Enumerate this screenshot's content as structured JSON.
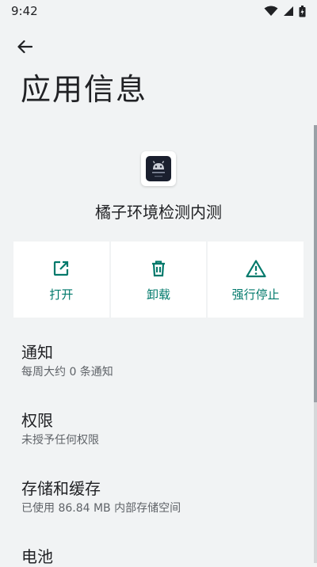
{
  "status_bar": {
    "time": "9:42"
  },
  "page": {
    "title": "应用信息"
  },
  "app": {
    "name": "橘子环境检测内测"
  },
  "actions": [
    {
      "label": "打开",
      "icon": "open-external-icon"
    },
    {
      "label": "卸载",
      "icon": "trash-icon"
    },
    {
      "label": "强行停止",
      "icon": "warning-icon"
    }
  ],
  "settings": [
    {
      "title": "通知",
      "subtitle": "每周大约 0 条通知"
    },
    {
      "title": "权限",
      "subtitle": "未授予任何权限"
    },
    {
      "title": "存储和缓存",
      "subtitle": "已使用 86.84 MB 内部存储空间"
    },
    {
      "title": "电池"
    }
  ],
  "colors": {
    "accent": "#00796b",
    "background": "#f1f3f4",
    "card": "#ffffff"
  }
}
